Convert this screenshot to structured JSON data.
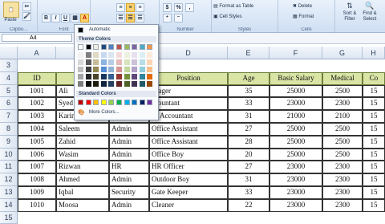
{
  "ribbon": {
    "paste_label": "Paste",
    "clipboard_label": "Clipbo...",
    "font_label": "Font",
    "alignment_label": "",
    "number_label": "Number",
    "currency_symbol": "$",
    "percent_symbol": "%",
    "comma_symbol": ",",
    "format_as_table": "Format as Table",
    "cell_styles": "Cell Styles",
    "styles_label": "Styles",
    "delete_label": "Delete",
    "format_label": "Format",
    "cells_label": "Cells",
    "sort_filter": "Sort &",
    "sort_filter2": "Filter",
    "find_select": "Find &",
    "find_select2": "Select",
    "bold": "B",
    "italic": "I",
    "underline": "U",
    "font_color_glyph": "A"
  },
  "namebox": {
    "value": "A4"
  },
  "columns": [
    "A",
    "B",
    "C",
    "D",
    "E",
    "F",
    "G",
    "H"
  ],
  "rows": [
    "3",
    "4",
    "5",
    "6",
    "7",
    "8",
    "9",
    "10",
    "11",
    "12",
    "13",
    "14",
    "15"
  ],
  "headers": [
    "ID",
    "",
    "",
    "Position",
    "Age",
    "Basic Salary",
    "Medical",
    "Co"
  ],
  "data": [
    [
      "1001",
      "Ali",
      "",
      "anager",
      "35",
      "25000",
      "2500",
      "15"
    ],
    [
      "1002",
      "Syed",
      "",
      "ccountant",
      "33",
      "23000",
      "2300",
      "15"
    ],
    [
      "1003",
      "Karim",
      "",
      "st. Accountant",
      "31",
      "21000",
      "2100",
      "15"
    ],
    [
      "1004",
      "Saleem",
      "Admin",
      "Office Assistant",
      "27",
      "25000",
      "2500",
      "15"
    ],
    [
      "1005",
      "Zahid",
      "Admin",
      "Office Assistant",
      "28",
      "25000",
      "2500",
      "15"
    ],
    [
      "1006",
      "Wasim",
      "Admin",
      "Office Boy",
      "20",
      "25000",
      "2500",
      "15"
    ],
    [
      "1007",
      "Rizwan",
      "HR",
      "HR Officer",
      "27",
      "23000",
      "2300",
      "15"
    ],
    [
      "1008",
      "Ahmed",
      "Admin",
      "Outdoor Boy",
      "31",
      "23000",
      "2300",
      "15"
    ],
    [
      "1009",
      "Iqbal",
      "Security",
      "Gate Keeper",
      "33",
      "23000",
      "2300",
      "15"
    ],
    [
      "1010",
      "Moosa",
      "Admin",
      "Cleaner",
      "22",
      "23000",
      "2300",
      "15"
    ]
  ],
  "picker": {
    "automatic": "Automatic",
    "theme_colors": "Theme Colors",
    "standard_colors": "Standard Colors",
    "more_colors": "More Colors...",
    "theme_top": [
      "#ffffff",
      "#000000",
      "#eeece1",
      "#1f497d",
      "#4f81bd",
      "#c0504d",
      "#9bbb59",
      "#8064a2",
      "#4bacc6",
      "#f79646"
    ],
    "theme_shades": [
      [
        "#f2f2f2",
        "#d8d8d8",
        "#bfbfbf",
        "#a5a5a5",
        "#7f7f7f"
      ],
      [
        "#7f7f7f",
        "#595959",
        "#3f3f3f",
        "#262626",
        "#0c0c0c"
      ],
      [
        "#ddd9c3",
        "#c4bd97",
        "#938953",
        "#494429",
        "#1d1b10"
      ],
      [
        "#c6d9f0",
        "#8db3e2",
        "#548dd4",
        "#17365d",
        "#0f243e"
      ],
      [
        "#dbe5f1",
        "#b8cce4",
        "#95b3d7",
        "#366092",
        "#244061"
      ],
      [
        "#f2dcdb",
        "#e5b9b7",
        "#d99694",
        "#953734",
        "#632423"
      ],
      [
        "#ebf1dd",
        "#d7e3bc",
        "#c3d69b",
        "#76923c",
        "#4f6128"
      ],
      [
        "#e5e0ec",
        "#ccc1d9",
        "#b2a2c7",
        "#5f497a",
        "#3f3151"
      ],
      [
        "#dbeef3",
        "#b7dde8",
        "#92cddc",
        "#31859b",
        "#205867"
      ],
      [
        "#fdeada",
        "#fbd5b5",
        "#fac08f",
        "#e36c09",
        "#974806"
      ]
    ],
    "standard": [
      "#c00000",
      "#ff0000",
      "#ffc000",
      "#ffff00",
      "#92d050",
      "#00b050",
      "#00b0f0",
      "#0070c0",
      "#002060",
      "#7030a0"
    ]
  }
}
